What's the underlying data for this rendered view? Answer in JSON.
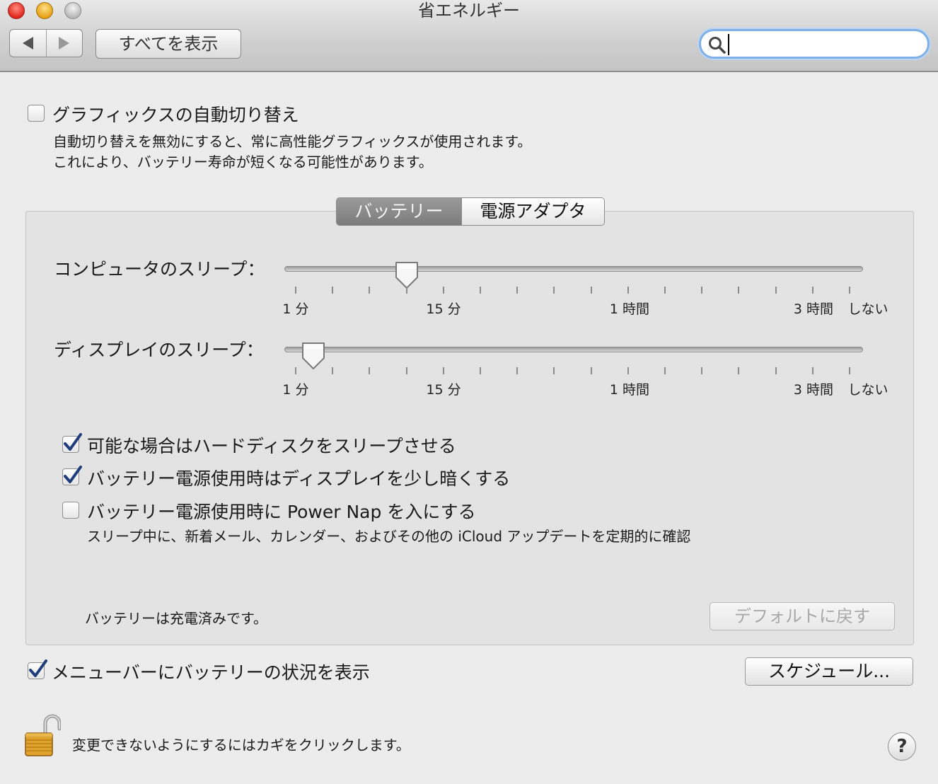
{
  "window": {
    "title": "省エネルギー"
  },
  "toolbar": {
    "show_all_label": "すべてを表示",
    "search": {
      "value": "",
      "placeholder": ""
    }
  },
  "graphics": {
    "checkbox_label": "グラフィックスの自動切り替え",
    "checked": false,
    "description_line1": "自動切り替えを無効にすると、常に高性能グラフィックスが使用されます。",
    "description_line2": "これにより、バッテリー寿命が短くなる可能性があります。"
  },
  "tabs": [
    {
      "label": "バッテリー",
      "selected": true
    },
    {
      "label": "電源アダプタ",
      "selected": false
    }
  ],
  "sliders": {
    "computer_sleep": {
      "label": "コンピュータのスリープ：",
      "value": "15 分"
    },
    "display_sleep": {
      "label": "ディスプレイのスリープ：",
      "value": "5 分"
    },
    "tick_labels": [
      "1 分",
      "15 分",
      "1 時間",
      "3 時間",
      "しない"
    ]
  },
  "options": {
    "disk_sleep": {
      "label": "可能な場合はハードディスクをスリープさせる",
      "checked": true
    },
    "dim_display": {
      "label": "バッテリー電源使用時はディスプレイを少し暗くする",
      "checked": true
    },
    "power_nap": {
      "label": "バッテリー電源使用時に Power Nap を入にする",
      "checked": false,
      "description": "スリープ中に、新着メール、カレンダー、およびその他の iCloud アップデートを定期的に確認"
    }
  },
  "battery_status": "バッテリーは充電済みです。",
  "restore_defaults_label": "デフォルトに戻す",
  "menubar_option": {
    "label": "メニューバーにバッテリーの状況を表示",
    "checked": true
  },
  "schedule_label": "スケジュール...",
  "lock_text": "変更できないようにするにはカギをクリックします。",
  "help_label": "?",
  "colors": {
    "checkmark": "#1f3d7a",
    "search_focus": "#7fb0e6",
    "tab_active": "#8a8a8a"
  }
}
